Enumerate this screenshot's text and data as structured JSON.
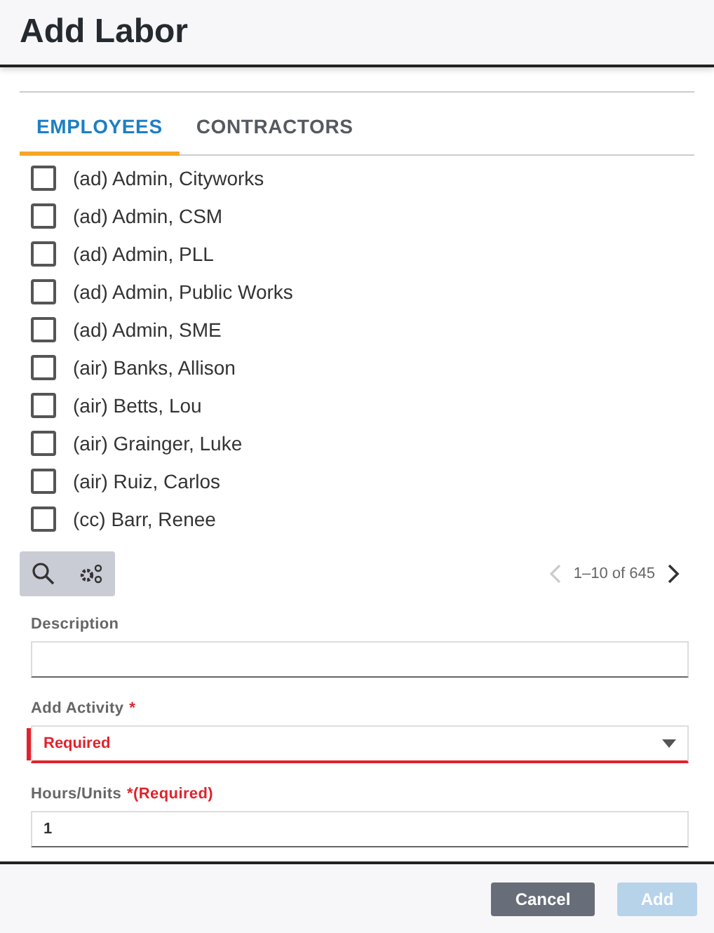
{
  "dialog": {
    "title": "Add Labor"
  },
  "tabs": [
    {
      "label": "EMPLOYEES",
      "selected": true
    },
    {
      "label": "CONTRACTORS",
      "selected": false
    }
  ],
  "employees": [
    {
      "name": "(ad) Admin, Cityworks",
      "checked": false
    },
    {
      "name": "(ad) Admin, CSM",
      "checked": false
    },
    {
      "name": "(ad) Admin, PLL",
      "checked": false
    },
    {
      "name": "(ad) Admin, Public Works",
      "checked": false
    },
    {
      "name": "(ad) Admin, SME",
      "checked": false
    },
    {
      "name": "(air) Banks, Allison",
      "checked": false
    },
    {
      "name": "(air) Betts, Lou",
      "checked": false
    },
    {
      "name": "(air) Grainger, Luke",
      "checked": false
    },
    {
      "name": "(air) Ruiz, Carlos",
      "checked": false
    },
    {
      "name": "(cc) Barr, Renee",
      "checked": false
    }
  ],
  "pager": {
    "range": "1–10 of 645",
    "previous_disabled": true,
    "next_disabled": false
  },
  "fields": [
    {
      "kind": "text",
      "label": "Description"
    },
    {
      "kind": "select",
      "label": "Add Activity",
      "required_mark": "*",
      "placeholder": "Required",
      "invalid": true
    },
    {
      "kind": "text",
      "label": "Hours/Units",
      "required_mark": "*(Required)",
      "value": "1"
    }
  ],
  "buttons": [
    {
      "label": "Cancel",
      "kind": "secondary",
      "disabled": false
    },
    {
      "label": "Add",
      "kind": "primary",
      "disabled": true
    }
  ]
}
